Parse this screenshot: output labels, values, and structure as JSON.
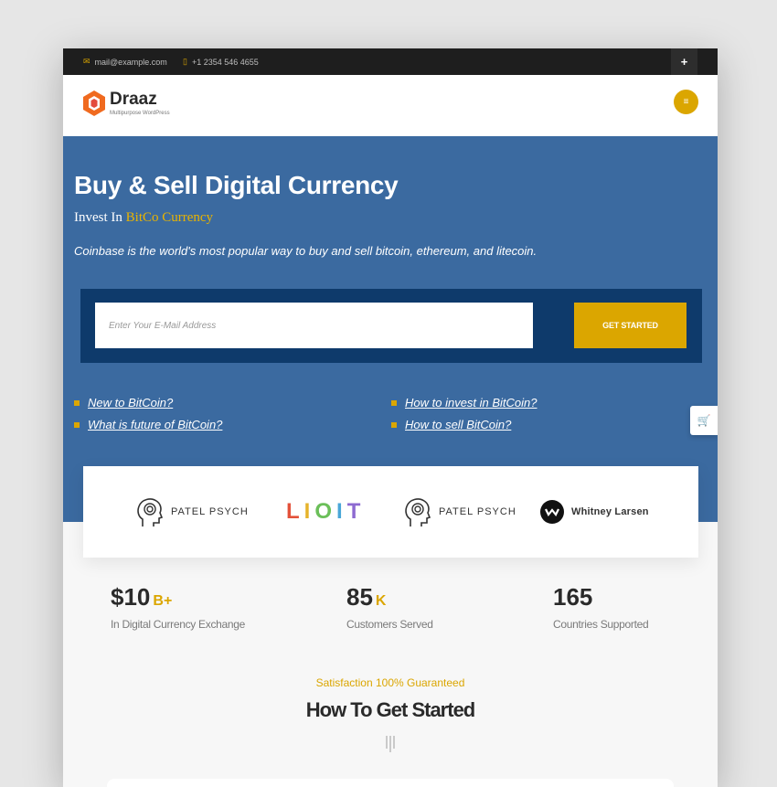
{
  "topbar": {
    "email": "mail@example.com",
    "phone": "+1 2354 546 4655",
    "email_icon": "envelope-icon",
    "phone_icon": "phone-icon",
    "plus_label": "+"
  },
  "header": {
    "logo_name": "Draaz",
    "logo_tagline": "Multipurpose WordPress",
    "menu_icon": "hamburger-icon"
  },
  "hero": {
    "title": "Buy & Sell Digital Currency",
    "subtitle_prefix": "Invest In ",
    "subtitle_highlight": "BitCo Currency",
    "description": "Coinbase is the world's most popular way to buy and sell bitcoin, ethereum, and litecoin.",
    "email_placeholder": "Enter Your E-Mail Address",
    "cta_label": "GET STARTED",
    "links": [
      "New to BitCoin?",
      "How to invest in BitCoin?",
      "What is future of BitCoin?",
      "How to sell BitCoin?"
    ]
  },
  "clients": [
    "PATEL PSYCH",
    "LIOIT",
    "PATEL PSYCH",
    "Whitney Larsen"
  ],
  "stats": [
    {
      "value": "$10",
      "suffix": "B+",
      "label": "In Digital Currency Exchange"
    },
    {
      "value": "85",
      "suffix": "K",
      "label": "Customers Served"
    },
    {
      "value": "165",
      "suffix": "",
      "label": "Countries Supported"
    }
  ],
  "section": {
    "eyebrow": "Satisfaction 100% Guaranteed",
    "heading": "How To Get Started"
  },
  "colors": {
    "accent": "#dba600",
    "hero_bg": "#3b6aa0",
    "signup_bg": "#0e3a6b",
    "topbar_bg": "#1e1e1e"
  }
}
